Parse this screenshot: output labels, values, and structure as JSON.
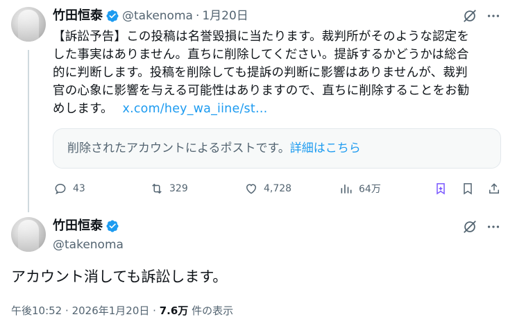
{
  "tweet1": {
    "name": "竹田恒泰",
    "handle": "@takenoma",
    "separator": "·",
    "date": "1月20日",
    "text_lines": [
      "【訴訟予告】この投稿は名誉毀損に当たります。裁判所がそのような認定を",
      "した事実はありません。直ちに削除してください。提訴するかどうかは総合",
      "的に判断します。投稿を削除しても提訴の判断に影響はありませんが、裁判",
      "官の心象に影響を与える可能性はありますので、直ちに削除することをお勧"
    ],
    "text_last": "めします。",
    "link": "x.com/hey_wa_iine/st…",
    "quote": {
      "text": "削除されたアカウントによるポストです。",
      "more_link": "詳細はこちら"
    },
    "actions": {
      "replies": "43",
      "reposts": "329",
      "likes": "4,728",
      "views": "64万"
    },
    "icons": {
      "grok": "grok-icon",
      "more": "more-icon",
      "reply": "reply-icon",
      "repost": "repost-icon",
      "like": "heart-icon",
      "views": "views-icon",
      "premium_bookmark": "premium-bookmark-icon",
      "bookmark": "bookmark-icon",
      "share": "share-icon"
    }
  },
  "tweet2": {
    "name": "竹田恒泰",
    "handle": "@takenoma",
    "text": "アカウント消しても訴訟します。",
    "time": "午後10:52",
    "sep1": "·",
    "date": "2026年1月20日",
    "sep2": "·",
    "views_count": "7.6万",
    "views_label": "件の表示"
  },
  "colors": {
    "accent": "#1d9bf0",
    "text": "#0f1419",
    "muted": "#536471",
    "premium": "#7856ff"
  }
}
